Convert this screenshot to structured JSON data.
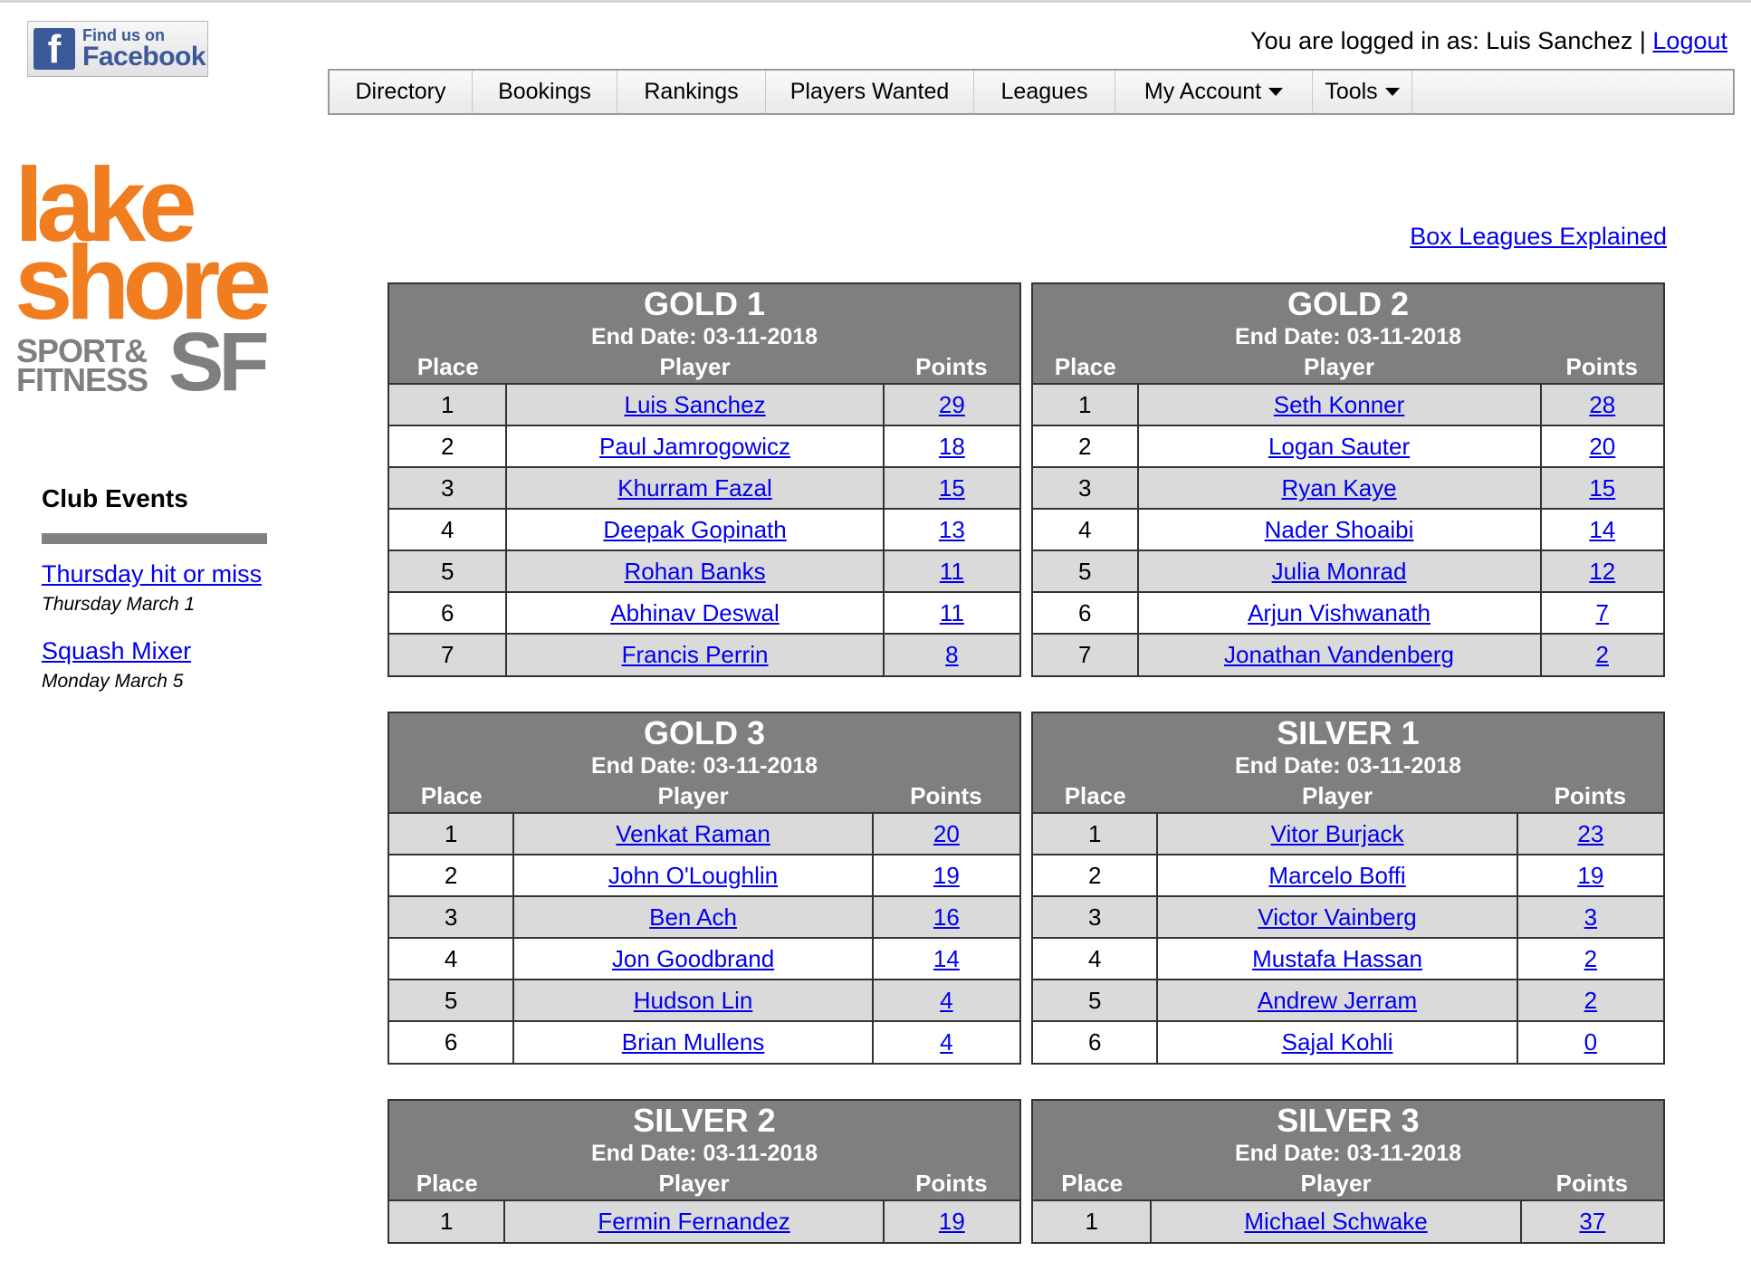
{
  "facebook": {
    "small": "Find us on",
    "big": "Facebook",
    "glyph": "f",
    "color": "#3b5998"
  },
  "login": {
    "prefix": "You are logged in as: Luis Sanchez |",
    "logout": "Logout"
  },
  "nav": [
    {
      "label": "Directory",
      "dropdown": false
    },
    {
      "label": "Bookings",
      "dropdown": false
    },
    {
      "label": "Rankings",
      "dropdown": false
    },
    {
      "label": "Players Wanted",
      "dropdown": false
    },
    {
      "label": "Leagues",
      "dropdown": false
    },
    {
      "label": "My Account",
      "dropdown": true
    },
    {
      "label": "Tools",
      "dropdown": true
    }
  ],
  "logo": {
    "line1": "lake",
    "line2": "shore",
    "line3a": "SPORT&",
    "line3b": "FITNESS",
    "line3c": "SF",
    "accent": "#f07d20",
    "gray": "#7f7f7f"
  },
  "club_events": {
    "title": "Club Events",
    "items": [
      {
        "name": "Thursday hit or miss",
        "date": "Thursday March 1"
      },
      {
        "name": "Squash Mixer",
        "date": "Monday March 5"
      }
    ]
  },
  "box_leagues_link": "Box Leagues Explained",
  "columns": {
    "place": "Place",
    "player": "Player",
    "points": "Points"
  },
  "leagues": [
    {
      "title": "GOLD 1",
      "end_date": "End Date: 03-11-2018",
      "rows": [
        [
          "1",
          "Luis Sanchez",
          "29"
        ],
        [
          "2",
          "Paul Jamrogowicz",
          "18"
        ],
        [
          "3",
          "Khurram Fazal",
          "15"
        ],
        [
          "4",
          "Deepak Gopinath",
          "13"
        ],
        [
          "5",
          "Rohan Banks",
          "11"
        ],
        [
          "6",
          "Abhinav Deswal",
          "11"
        ],
        [
          "7",
          "Francis Perrin",
          "8"
        ]
      ]
    },
    {
      "title": "GOLD 2",
      "end_date": "End Date: 03-11-2018",
      "rows": [
        [
          "1",
          "Seth Konner",
          "28"
        ],
        [
          "2",
          "Logan Sauter",
          "20"
        ],
        [
          "3",
          "Ryan Kaye",
          "15"
        ],
        [
          "4",
          "Nader Shoaibi",
          "14"
        ],
        [
          "5",
          "Julia Monrad",
          "12"
        ],
        [
          "6",
          "Arjun Vishwanath",
          "7"
        ],
        [
          "7",
          "Jonathan Vandenberg",
          "2"
        ]
      ]
    },
    {
      "title": "GOLD 3",
      "end_date": "End Date: 03-11-2018",
      "rows": [
        [
          "1",
          "Venkat Raman",
          "20"
        ],
        [
          "2",
          "John O'Loughlin",
          "19"
        ],
        [
          "3",
          "Ben Ach",
          "16"
        ],
        [
          "4",
          "Jon Goodbrand",
          "14"
        ],
        [
          "5",
          "Hudson Lin",
          "4"
        ],
        [
          "6",
          "Brian Mullens",
          "4"
        ]
      ]
    },
    {
      "title": "SILVER 1",
      "end_date": "End Date: 03-11-2018",
      "rows": [
        [
          "1",
          "Vitor Burjack",
          "23"
        ],
        [
          "2",
          "Marcelo Boffi",
          "19"
        ],
        [
          "3",
          "Victor Vainberg",
          "3"
        ],
        [
          "4",
          "Mustafa Hassan",
          "2"
        ],
        [
          "5",
          "Andrew Jerram",
          "2"
        ],
        [
          "6",
          "Sajal Kohli",
          "0"
        ]
      ]
    },
    {
      "title": "SILVER 2",
      "end_date": "End Date: 03-11-2018",
      "rows": [
        [
          "1",
          "Fermin Fernandez",
          "19"
        ]
      ]
    },
    {
      "title": "SILVER 3",
      "end_date": "End Date: 03-11-2018",
      "rows": [
        [
          "1",
          "Michael Schwake",
          "37"
        ]
      ]
    }
  ]
}
